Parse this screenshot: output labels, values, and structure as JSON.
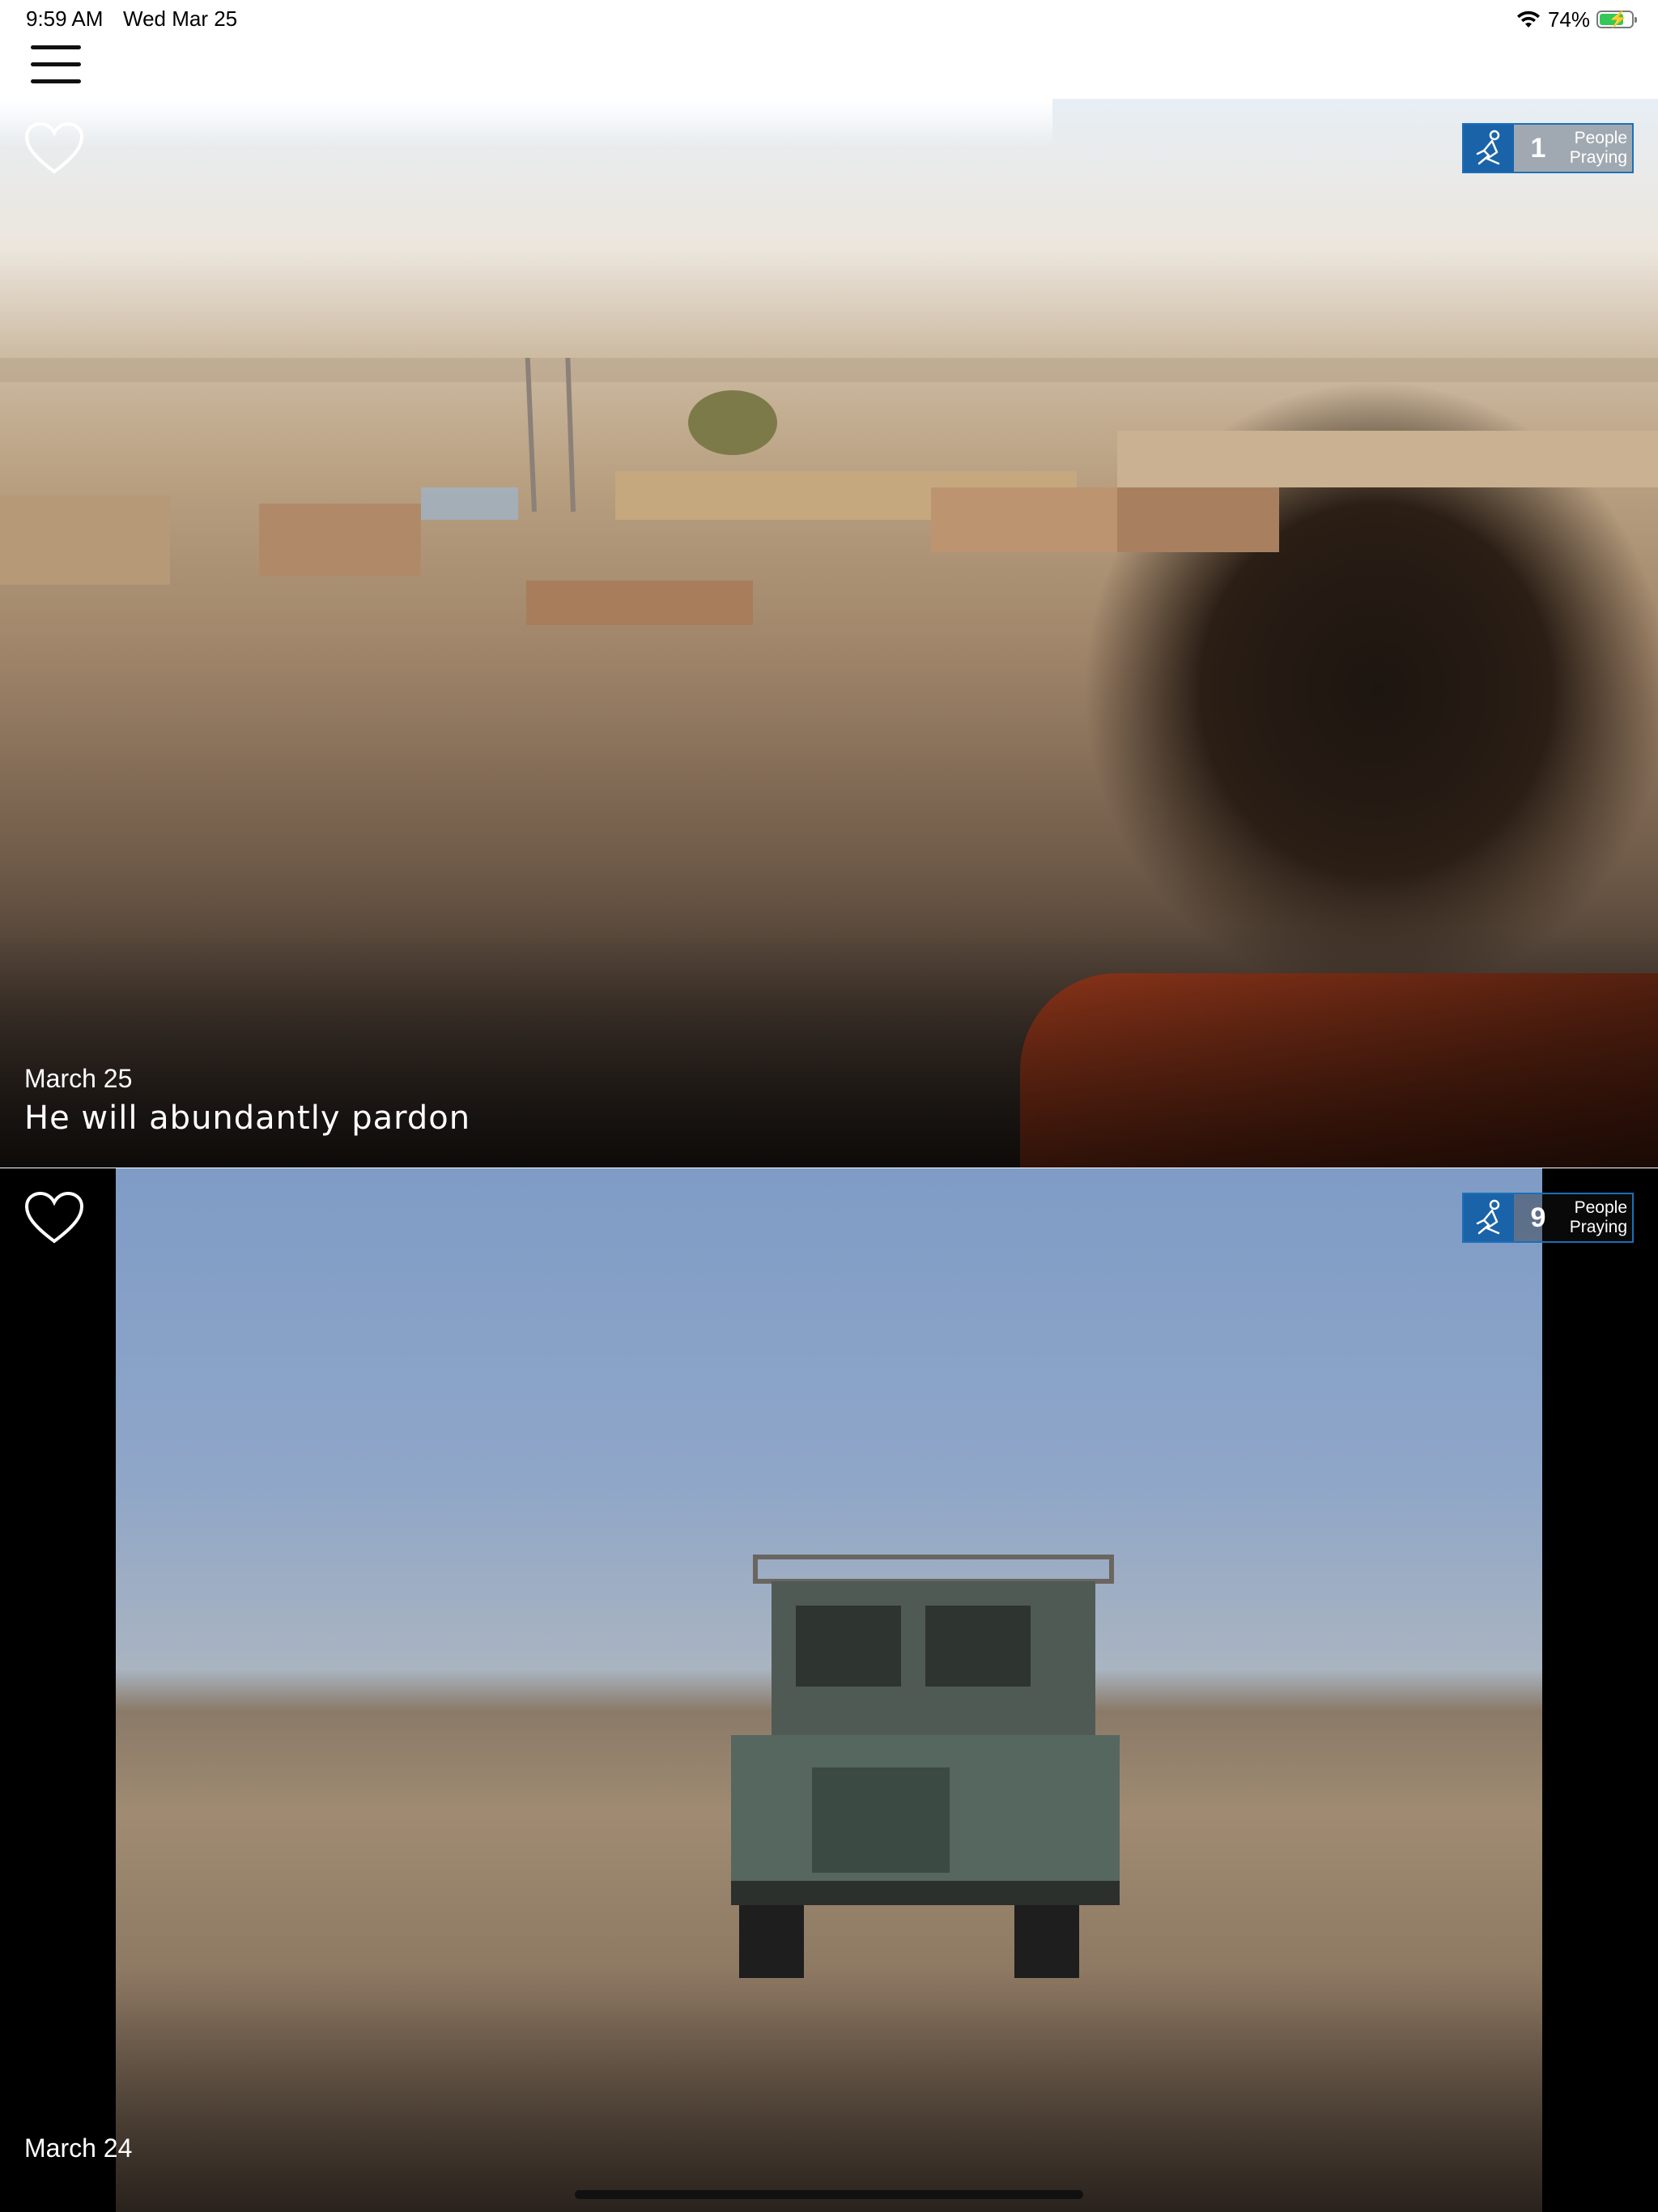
{
  "status_bar": {
    "time": "9:59 AM",
    "date": "Wed Mar 25",
    "battery_percent": "74%",
    "icons": [
      "wifi-icon",
      "battery-charging-icon"
    ]
  },
  "header": {
    "menu_icon": "hamburger-menu-icon"
  },
  "cards": [
    {
      "date": "March 25",
      "title": "He will abundantly pardon",
      "people_praying_count": "1",
      "people_praying_label_line1": "People",
      "people_praying_label_line2": "Praying",
      "favorite_icon": "heart-outline-icon",
      "praying_icon": "praying-person-icon"
    },
    {
      "date": "March 24",
      "title": "",
      "people_praying_count": "9",
      "people_praying_label_line1": "People",
      "people_praying_label_line2": "Praying",
      "favorite_icon": "heart-outline-icon",
      "praying_icon": "praying-person-icon"
    }
  ],
  "colors": {
    "badge_blue": "#1a63a8",
    "text_on_image": "#ffffff",
    "battery_green": "#35c759"
  }
}
